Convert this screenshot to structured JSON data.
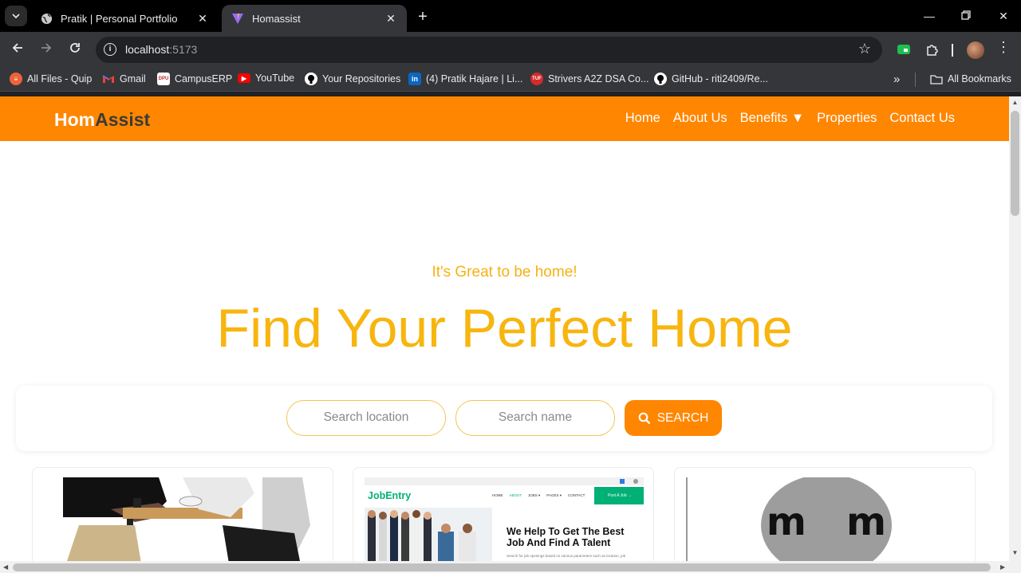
{
  "browser": {
    "tabs": [
      {
        "title": "Pratik | Personal Portfolio",
        "favicon": "globe-icon",
        "active": false
      },
      {
        "title": "Homassist",
        "favicon": "vite-icon",
        "active": true
      }
    ],
    "url_host": "localhost",
    "url_port": ":5173",
    "bookmarks": [
      {
        "label": "All Files - Quip",
        "icon": "quip-icon"
      },
      {
        "label": "Gmail",
        "icon": "gmail-icon"
      },
      {
        "label": "CampusERP",
        "icon": "campuserp-icon"
      },
      {
        "label": "YouTube",
        "icon": "youtube-icon"
      },
      {
        "label": "Your Repositories",
        "icon": "github-icon"
      },
      {
        "label": "(4) Pratik Hajare | Li...",
        "icon": "linkedin-icon"
      },
      {
        "label": "Strivers A2Z DSA Co...",
        "icon": "tuf-icon"
      },
      {
        "label": "GitHub - riti2409/Re...",
        "icon": "github-icon"
      }
    ],
    "all_bookmarks": "All Bookmarks",
    "overflow": "»"
  },
  "site": {
    "logo_part1": "Hom",
    "logo_part2": "Assist",
    "nav": [
      "Home",
      "About Us",
      "Benefits ▼",
      "Properties",
      "Contact Us"
    ],
    "tagline": "It's Great to be home!",
    "headline": "Find Your Perfect Home",
    "search": {
      "location_placeholder": "Search location",
      "name_placeholder": "Search name",
      "button_label": "SEARCH"
    },
    "card2": {
      "brand": "JobEntry",
      "menu": [
        "HOME",
        "ABOUT",
        "JOBS ▾",
        "PAGES ▾",
        "CONTACT"
      ],
      "cta": "Post A Job →",
      "heading_line1": "We Help To Get The Best",
      "heading_line2": "Job And Find A Talent",
      "body": "Search for job openings based on various parameters such as location, job"
    },
    "card3": {
      "letters": "m   m"
    }
  },
  "colors": {
    "brand_orange": "#ff8600",
    "headline_yellow": "#f7b50f"
  }
}
